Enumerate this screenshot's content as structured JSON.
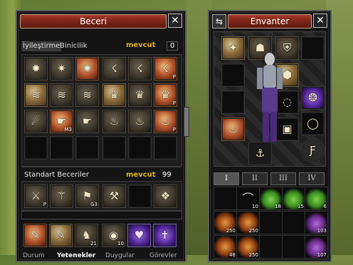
{
  "beceri": {
    "title": "Beceri",
    "close": "✕",
    "tabs": [
      "İyileştirme",
      "Binicilik"
    ],
    "mevcut_label": "mevcut",
    "mevcut_value": "0",
    "standart_label": "Standart Beceriler",
    "standart_mevcut_label": "mevcut",
    "standart_mevcut_value": "99",
    "skill_tags": {
      "r0c5": "P",
      "r1c5": "P",
      "r2c1": "M3",
      "r2c5": "P"
    },
    "std_tags": {
      "s0": "P",
      "s2": "G3"
    },
    "bottom_tags": {
      "b2": "21",
      "b3": "10"
    },
    "bottom_tabs": [
      "Durum",
      "Yetenekler",
      "Duygular",
      "Görevler"
    ]
  },
  "envanter": {
    "title": "Envanter",
    "close": "✕",
    "pages": [
      "I",
      "II",
      "III",
      "IV"
    ],
    "active_page": "I",
    "row1_counts": [
      "",
      "10",
      "18",
      "15",
      "6"
    ],
    "row2_counts": [
      "250",
      "250",
      "",
      "",
      "103"
    ],
    "row3_counts": [
      "48",
      "250",
      "",
      "",
      "107"
    ]
  }
}
